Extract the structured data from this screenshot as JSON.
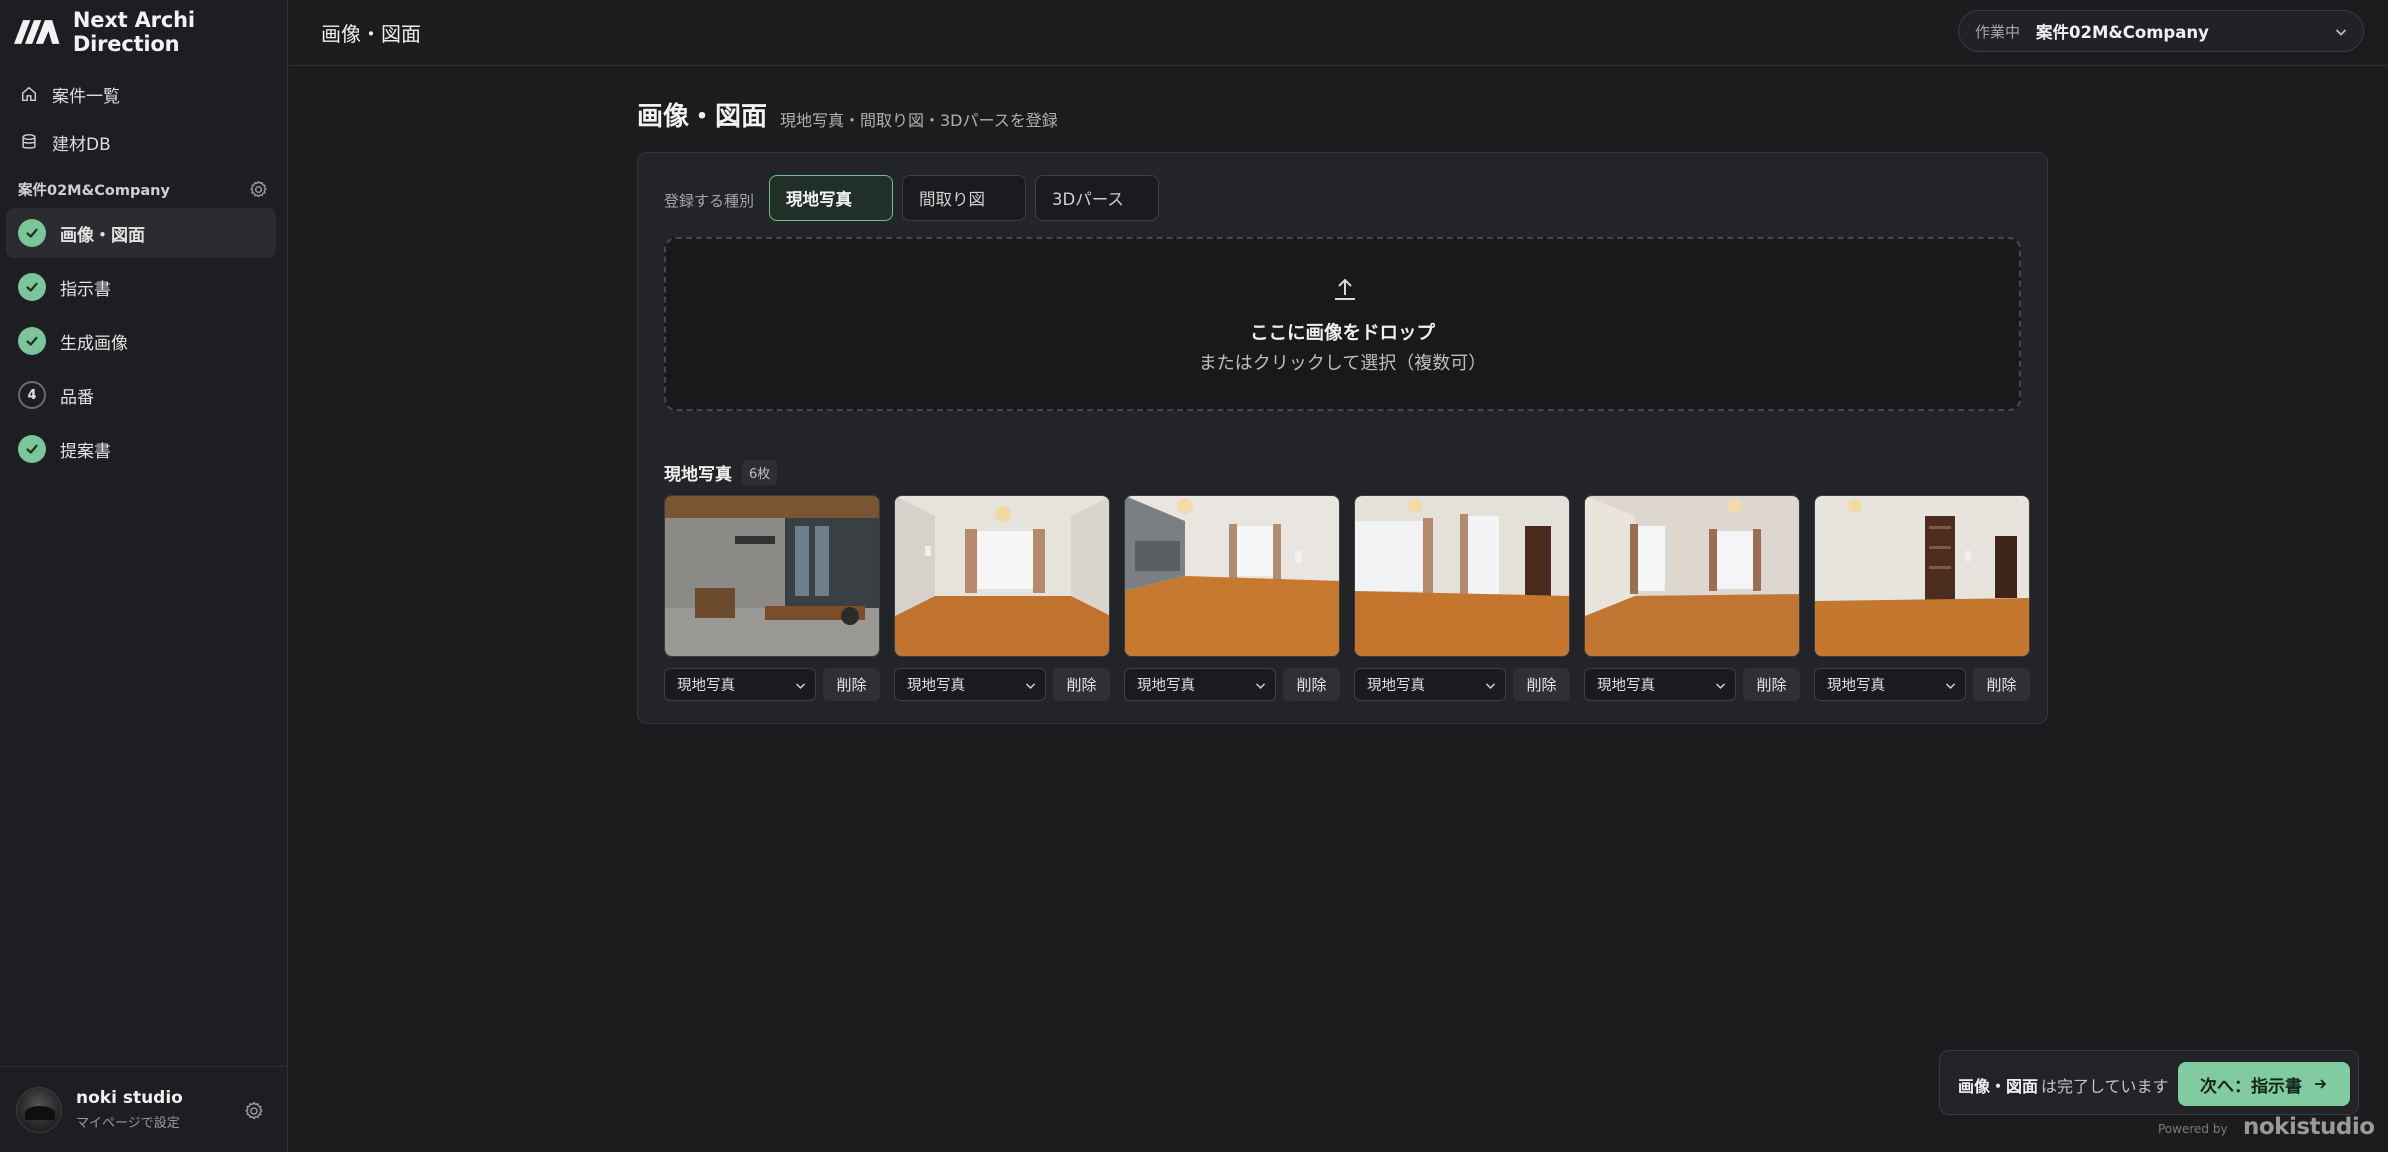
{
  "app": {
    "brand": "Next Archi Direction"
  },
  "sidebar": {
    "nav": [
      {
        "label": "案件一覧",
        "icon": "home-icon"
      },
      {
        "label": "建材DB",
        "icon": "database-icon"
      }
    ],
    "project_name": "案件02M&Company",
    "steps": [
      {
        "label": "画像・図面",
        "status": "done",
        "active": true
      },
      {
        "label": "指示書",
        "status": "done"
      },
      {
        "label": "生成画像",
        "status": "done"
      },
      {
        "label": "品番",
        "status": "pending",
        "number": "4"
      },
      {
        "label": "提案書",
        "status": "done"
      }
    ],
    "user": {
      "name": "noki studio",
      "sub": "マイページで設定"
    }
  },
  "header": {
    "title": "画像・図面",
    "workspace_label": "作業中",
    "workspace_value": "案件02M&Company"
  },
  "main": {
    "title": "画像・図面",
    "subtitle": "現地写真・間取り図・3Dパースを登録",
    "type_label": "登録する種別",
    "types": [
      "現地写真",
      "間取り図",
      "3Dパース"
    ],
    "selected_type": "現地写真",
    "dropzone": {
      "title": "ここに画像をドロップ",
      "sub": "またはクリックして選択（複数可）"
    },
    "gallery": {
      "title": "現地写真",
      "count": "6枚",
      "photos": [
        {
          "type": "現地写真",
          "delete": "削除",
          "scene": "office"
        },
        {
          "type": "現地写真",
          "delete": "削除",
          "scene": "room"
        },
        {
          "type": "現地写真",
          "delete": "削除",
          "scene": "kitchen"
        },
        {
          "type": "現地写真",
          "delete": "削除",
          "scene": "room-door"
        },
        {
          "type": "現地写真",
          "delete": "削除",
          "scene": "room-corner"
        },
        {
          "type": "現地写真",
          "delete": "削除",
          "scene": "room-shelf"
        }
      ]
    }
  },
  "footer": {
    "done_bold": "画像・図面",
    "done_text": "は完了しています",
    "next_label": "次へ：指示書",
    "powered_by": "Powered by",
    "powered_logo": "nokistudio"
  },
  "colors": {
    "accent": "#82cba0",
    "background": "#1b1c1e",
    "check": "#7cc49a"
  }
}
